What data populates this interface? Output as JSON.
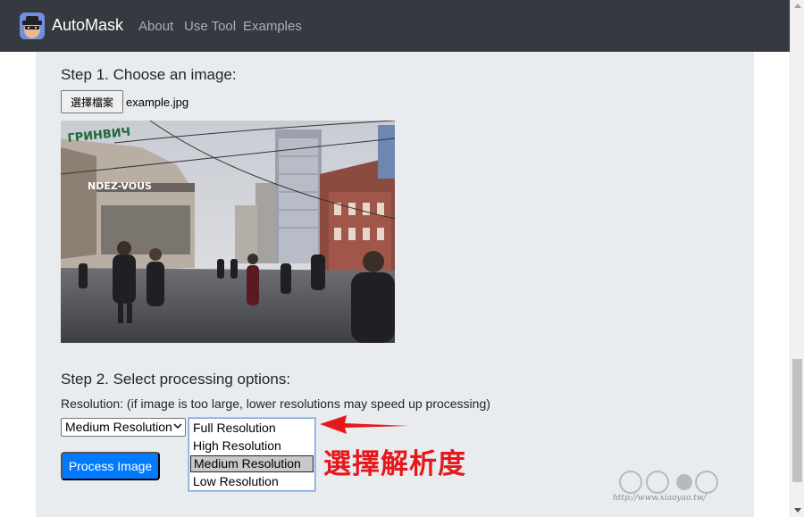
{
  "navbar": {
    "brand": "AutoMask",
    "links": [
      "About",
      "Use Tool",
      "Examples"
    ]
  },
  "step1": {
    "heading": "Step 1. Choose an image:",
    "file_button": "選擇檔案",
    "file_name": "example.jpg"
  },
  "step2": {
    "heading": "Step 2. Select processing options:",
    "resolution_label": "Resolution: (if image is too large, lower resolutions may speed up processing)",
    "selected_value": "Medium Resolution",
    "options": [
      "Full Resolution",
      "High Resolution",
      "Medium Resolution",
      "Low Resolution"
    ],
    "process_button": "Process Image"
  },
  "photo_signs": {
    "left_sign": "ГРИНВИЧ",
    "mall_sign": "NDEZ-VOUS"
  },
  "annotation": {
    "text": "選擇解析度",
    "color": "#e8171c"
  },
  "watermark": {
    "url": "http://www.xiaoyao.tw/"
  },
  "colors": {
    "navbar_bg": "#343a40",
    "panel_bg": "#e9ecef",
    "primary": "#007bff"
  }
}
